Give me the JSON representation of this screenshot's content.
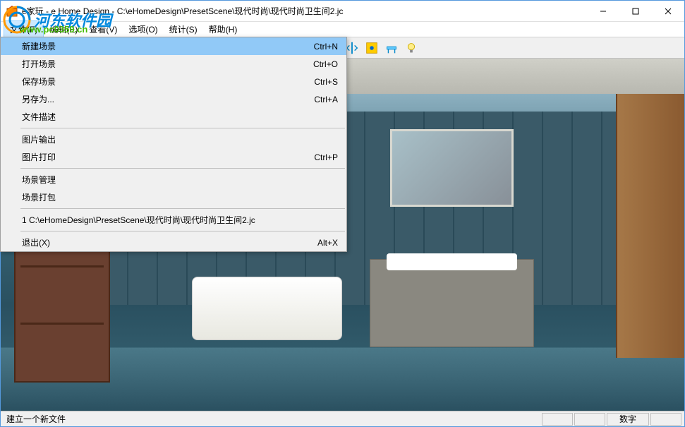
{
  "window": {
    "title": "e家玩 - e Home Design - C:\\eHomeDesign\\PresetScene\\现代时尚\\现代时尚卫生间2.jc"
  },
  "menubar": {
    "items": [
      {
        "label": "文件(F)"
      },
      {
        "label": "编辑(E)"
      },
      {
        "label": "查看(V)"
      },
      {
        "label": "选项(O)"
      },
      {
        "label": "统计(S)"
      },
      {
        "label": "帮助(H)"
      }
    ]
  },
  "file_menu": {
    "items": [
      {
        "label": "新建场景",
        "shortcut": "Ctrl+N",
        "highlighted": true
      },
      {
        "label": "打开场景",
        "shortcut": "Ctrl+O"
      },
      {
        "label": "保存场景",
        "shortcut": "Ctrl+S"
      },
      {
        "label": "另存为...",
        "shortcut": "Ctrl+A"
      },
      {
        "label": "文件描述",
        "shortcut": ""
      },
      {
        "sep": true
      },
      {
        "label": "图片输出",
        "shortcut": ""
      },
      {
        "label": "图片打印",
        "shortcut": "Ctrl+P"
      },
      {
        "sep": true
      },
      {
        "label": "场景管理",
        "shortcut": ""
      },
      {
        "label": "场景打包",
        "shortcut": ""
      },
      {
        "sep": true
      },
      {
        "label": "1 C:\\eHomeDesign\\PresetScene\\现代时尚\\现代时尚卫生间2.jc",
        "shortcut": ""
      },
      {
        "sep": true
      },
      {
        "label": "退出(X)",
        "shortcut": "Alt+X"
      }
    ]
  },
  "statusbar": {
    "left": "建立一个新文件",
    "right": "数字"
  },
  "watermark": {
    "text": "河东软件园",
    "url": "www.pc0359.cn"
  }
}
